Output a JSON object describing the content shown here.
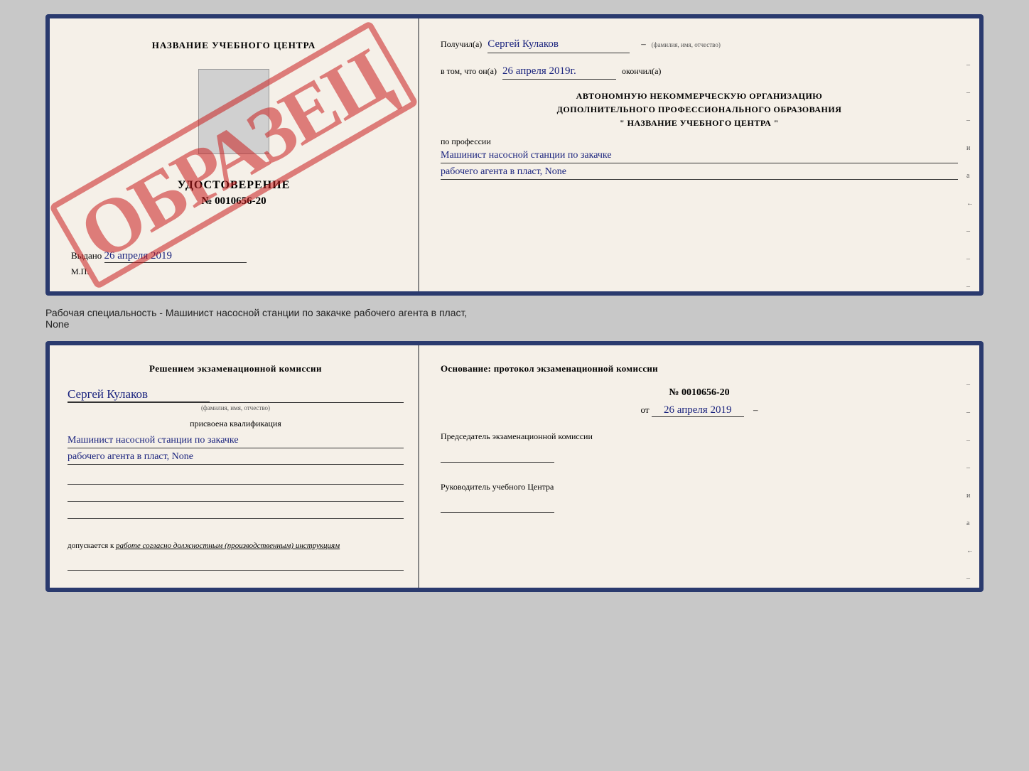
{
  "top_cert": {
    "left": {
      "title": "НАЗВАНИЕ УЧЕБНОГО ЦЕНТРА",
      "watermark": "ОБРАЗЕЦ",
      "udostoverenie": "УДОСТОВЕРЕНИЕ",
      "number": "№ 0010656-20",
      "vydano_label": "Выдано",
      "vydano_date": "26 апреля 2019",
      "mp": "М.П."
    },
    "right": {
      "poluchil_label": "Получил(а)",
      "poluchil_value": "Сергей Кулаков",
      "fio_hint": "(фамилия, имя, отчество)",
      "vtom_label": "в том, что он(а)",
      "vtom_date": "26 апреля 2019г.",
      "okonchil": "окончил(а)",
      "org_line1": "АВТОНОМНУЮ НЕКОММЕРЧЕСКУЮ ОРГАНИЗАЦИЮ",
      "org_line2": "ДОПОЛНИТЕЛЬНОГО ПРОФЕССИОНАЛЬНОГО ОБРАЗОВАНИЯ",
      "org_line3": "\"   НАЗВАНИЕ УЧЕБНОГО ЦЕНТРА   \"",
      "po_professii": "по профессии",
      "profession_line1": "Машинист насосной станции по закачке",
      "profession_line2": "рабочего агента в пласт, None",
      "dashes": [
        "-",
        "-",
        "-",
        "и",
        "а",
        "←",
        "-",
        "-",
        "-"
      ]
    }
  },
  "separator": {
    "text": "Рабочая специальность - Машинист насосной станции по закачке рабочего агента в пласт,",
    "text2": "None"
  },
  "bottom_cert": {
    "left": {
      "komissia_title": "Решением  экзаменационной  комиссии",
      "name_value": "Сергей Кулаков",
      "fio_hint": "(фамилия, имя, отчество)",
      "prisvoena": "присвоена квалификация",
      "profession_line1": "Машинист насосной станции по закачке",
      "profession_line2": "рабочего агента в пласт, None",
      "dopusk_label": "допускается к",
      "dopusk_value": "работе согласно должностным (производственным) инструкциям"
    },
    "right": {
      "osnov_title": "Основание:  протокол  экзаменационной  комиссии",
      "proto_number": "№  0010656-20",
      "proto_date_prefix": "от",
      "proto_date": "26 апреля 2019",
      "predsedatel_title": "Председатель экзаменационной комиссии",
      "rukovoditel_title": "Руководитель учебного Центра",
      "dashes": [
        "-",
        "-",
        "-",
        "-",
        "и",
        "а",
        "←",
        "-",
        "-",
        "-",
        "-",
        "-"
      ]
    }
  }
}
